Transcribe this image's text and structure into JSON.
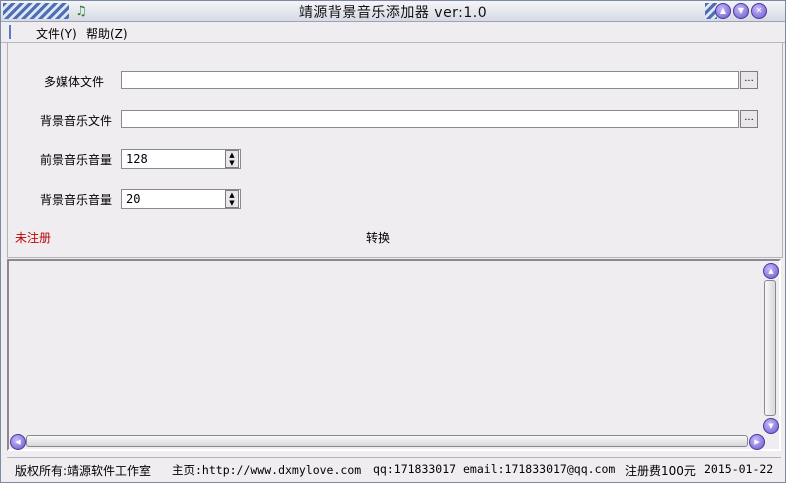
{
  "window": {
    "title": "靖源背景音乐添加器 ver:1.0",
    "icon": "music-note-icon"
  },
  "menu": {
    "items": [
      {
        "label": "文件(Y)"
      },
      {
        "label": "帮助(Z)"
      }
    ]
  },
  "form": {
    "multimedia_label": "多媒体文件",
    "multimedia_value": "",
    "bgm_label": "背景音乐文件",
    "bgm_value": "",
    "browse_label": "...",
    "fg_volume_label": "前景音乐音量",
    "fg_volume_value": "128",
    "bg_volume_label": "背景音乐音量",
    "bg_volume_value": "20",
    "unregistered": "未注册",
    "convert_label": "转换"
  },
  "log": {
    "text": ""
  },
  "status": {
    "copyright": "版权所有:靖源软件工作室",
    "homepage": "主页:http://www.dxmylove.com",
    "qq": "qq:171833017",
    "email": "email:171833017@qq.com",
    "fee": "注册费100元",
    "date": "2015-01-22"
  },
  "colors": {
    "accent": "#6a58c8",
    "warning": "#c00000"
  }
}
